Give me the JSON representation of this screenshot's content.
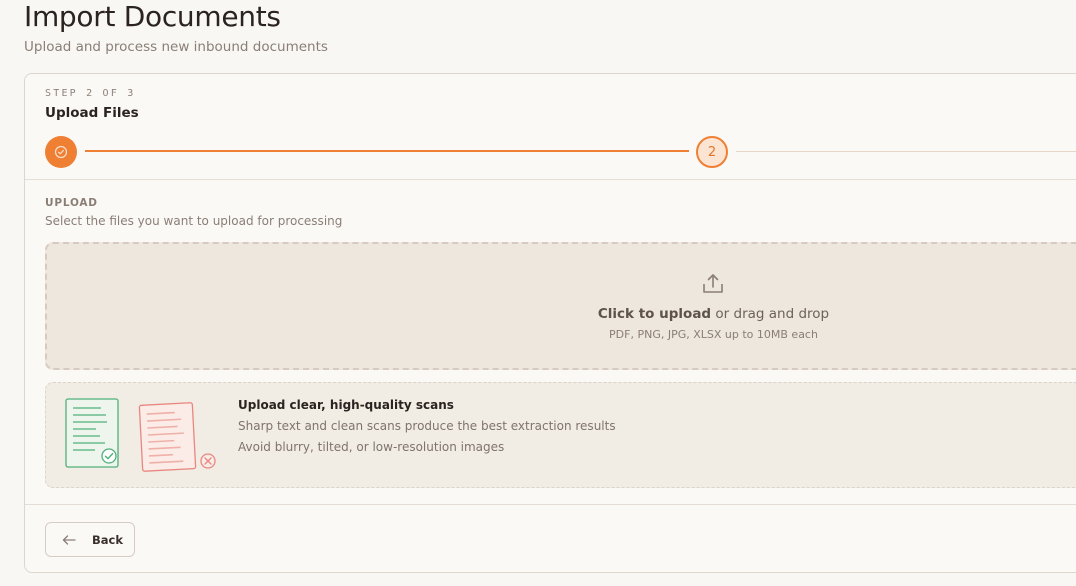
{
  "page": {
    "title": "Import Documents",
    "subtitle": "Upload and process new inbound documents"
  },
  "wizard": {
    "step_label": "STEP 2 OF 3",
    "step_title": "Upload Files",
    "current_step_number": "2",
    "accent_color": "#ef7f33"
  },
  "upload": {
    "label": "UPLOAD",
    "description": "Select the files you want to upload for processing",
    "dropzone": {
      "action_text": "Click to upload",
      "rest_text": " or drag and drop",
      "hint": "PDF, PNG, JPG, XLSX up to 10MB each",
      "icon": "upload-icon"
    }
  },
  "tips": {
    "title": "Upload clear, high-quality scans",
    "line1": "Sharp text and clean scans produce the best extraction results",
    "line2": "Avoid blurry, tilted, or low-resolution images",
    "good_color": "#4fb07a",
    "bad_color": "#e8877f"
  },
  "footer": {
    "back_label": "Back"
  }
}
